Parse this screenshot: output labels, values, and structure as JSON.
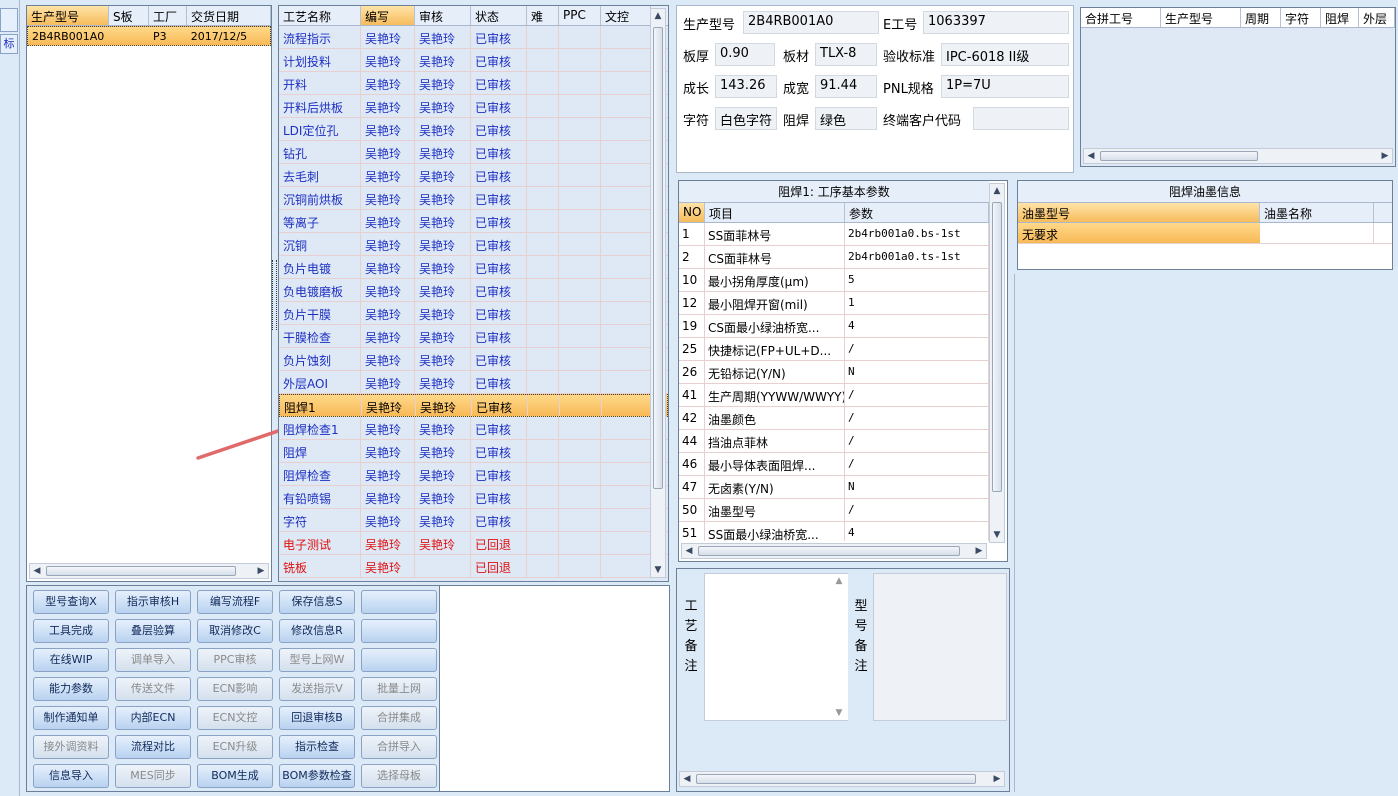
{
  "left_edge": {
    "top_label": "标"
  },
  "models": {
    "headers": [
      "生产型号",
      "S板",
      "工厂",
      "交货日期"
    ],
    "rows": [
      [
        "2B4RB001A0",
        "",
        "P3",
        "2017/12/5"
      ]
    ]
  },
  "process": {
    "headers": [
      "工艺名称",
      "编写",
      "审核",
      "状态",
      "难",
      "PPC",
      "文控"
    ],
    "rows": [
      {
        "name": "流程指示",
        "writer": "吴艳玲",
        "reviewer": "吴艳玲",
        "status": "已审核",
        "red": false
      },
      {
        "name": "计划投料",
        "writer": "吴艳玲",
        "reviewer": "吴艳玲",
        "status": "已审核",
        "red": false
      },
      {
        "name": "开料",
        "writer": "吴艳玲",
        "reviewer": "吴艳玲",
        "status": "已审核",
        "red": false
      },
      {
        "name": "开料后烘板",
        "writer": "吴艳玲",
        "reviewer": "吴艳玲",
        "status": "已审核",
        "red": false
      },
      {
        "name": "LDI定位孔",
        "writer": "吴艳玲",
        "reviewer": "吴艳玲",
        "status": "已审核",
        "red": false
      },
      {
        "name": "钻孔",
        "writer": "吴艳玲",
        "reviewer": "吴艳玲",
        "status": "已审核",
        "red": false
      },
      {
        "name": "去毛刺",
        "writer": "吴艳玲",
        "reviewer": "吴艳玲",
        "status": "已审核",
        "red": false
      },
      {
        "name": "沉铜前烘板",
        "writer": "吴艳玲",
        "reviewer": "吴艳玲",
        "status": "已审核",
        "red": false
      },
      {
        "name": "等离子",
        "writer": "吴艳玲",
        "reviewer": "吴艳玲",
        "status": "已审核",
        "red": false
      },
      {
        "name": "沉铜",
        "writer": "吴艳玲",
        "reviewer": "吴艳玲",
        "status": "已审核",
        "red": false
      },
      {
        "name": "负片电镀",
        "writer": "吴艳玲",
        "reviewer": "吴艳玲",
        "status": "已审核",
        "red": false
      },
      {
        "name": "负电镀磨板",
        "writer": "吴艳玲",
        "reviewer": "吴艳玲",
        "status": "已审核",
        "red": false
      },
      {
        "name": "负片干膜",
        "writer": "吴艳玲",
        "reviewer": "吴艳玲",
        "status": "已审核",
        "red": false
      },
      {
        "name": "干膜检查",
        "writer": "吴艳玲",
        "reviewer": "吴艳玲",
        "status": "已审核",
        "red": false
      },
      {
        "name": "负片蚀刻",
        "writer": "吴艳玲",
        "reviewer": "吴艳玲",
        "status": "已审核",
        "red": false
      },
      {
        "name": "外层AOI",
        "writer": "吴艳玲",
        "reviewer": "吴艳玲",
        "status": "已审核",
        "red": false
      },
      {
        "name": "阻焊1",
        "writer": "吴艳玲",
        "reviewer": "吴艳玲",
        "status": "已审核",
        "red": false,
        "selected": true
      },
      {
        "name": "阻焊检查1",
        "writer": "吴艳玲",
        "reviewer": "吴艳玲",
        "status": "已审核",
        "red": false
      },
      {
        "name": "阻焊",
        "writer": "吴艳玲",
        "reviewer": "吴艳玲",
        "status": "已审核",
        "red": false
      },
      {
        "name": "阻焊检查",
        "writer": "吴艳玲",
        "reviewer": "吴艳玲",
        "status": "已审核",
        "red": false
      },
      {
        "name": "有铅喷锡",
        "writer": "吴艳玲",
        "reviewer": "吴艳玲",
        "status": "已审核",
        "red": false
      },
      {
        "name": "字符",
        "writer": "吴艳玲",
        "reviewer": "吴艳玲",
        "status": "已审核",
        "red": false
      },
      {
        "name": "电子测试",
        "writer": "吴艳玲",
        "reviewer": "吴艳玲",
        "status": "已回退",
        "red": true
      },
      {
        "name": "铣板",
        "writer": "吴艳玲",
        "reviewer": "",
        "status": "已回退",
        "red": true
      }
    ]
  },
  "buttons": [
    [
      {
        "label": "型号查询X",
        "enabled": true
      },
      {
        "label": "指示审核H",
        "enabled": true
      },
      {
        "label": "编写流程F",
        "enabled": true
      },
      {
        "label": "保存信息S",
        "enabled": true
      },
      {
        "label": "",
        "enabled": true
      }
    ],
    [
      {
        "label": "工具完成",
        "enabled": true
      },
      {
        "label": "叠层验算",
        "enabled": true
      },
      {
        "label": "取消修改C",
        "enabled": true
      },
      {
        "label": "修改信息R",
        "enabled": true
      },
      {
        "label": "",
        "enabled": true
      }
    ],
    [
      {
        "label": "在线WIP",
        "enabled": true
      },
      {
        "label": "调单导入",
        "enabled": false
      },
      {
        "label": "PPC审核",
        "enabled": false
      },
      {
        "label": "型号上网W",
        "enabled": false
      },
      {
        "label": "",
        "enabled": true
      }
    ],
    [
      {
        "label": "能力参数",
        "enabled": true
      },
      {
        "label": "传送文件",
        "enabled": false
      },
      {
        "label": "ECN影响",
        "enabled": false
      },
      {
        "label": "发送指示V",
        "enabled": false
      },
      {
        "label": "批量上网",
        "enabled": false
      }
    ],
    [
      {
        "label": "制作通知单",
        "enabled": true
      },
      {
        "label": "内部ECN",
        "enabled": true
      },
      {
        "label": "ECN文控",
        "enabled": false
      },
      {
        "label": "回退审核B",
        "enabled": true
      },
      {
        "label": "合拼集成",
        "enabled": false
      }
    ],
    [
      {
        "label": "接外调资料",
        "enabled": false
      },
      {
        "label": "流程对比",
        "enabled": true
      },
      {
        "label": "ECN升级",
        "enabled": false
      },
      {
        "label": "指示检查",
        "enabled": true
      },
      {
        "label": "合拼导入",
        "enabled": false
      }
    ],
    [
      {
        "label": "信息导入",
        "enabled": true
      },
      {
        "label": "MES同步",
        "enabled": false
      },
      {
        "label": "BOM生成",
        "enabled": true
      },
      {
        "label": "BOM参数检查",
        "enabled": true
      },
      {
        "label": "选择母板",
        "enabled": false
      }
    ]
  ],
  "info": {
    "model_label": "生产型号",
    "model_value": "2B4RB001A0",
    "e_label": "E工号",
    "e_value": "1063397",
    "thickness_label": "板厚",
    "thickness_value": "0.90",
    "material_label": "板材",
    "material_value": "TLX-8",
    "standard_label": "验收标准",
    "standard_value": "IPC-6018 II级",
    "length_label": "成长",
    "length_value": "143.26",
    "width_label": "成宽",
    "width_value": "91.44",
    "pnl_label": "PNL规格",
    "pnl_value": "1P=7U",
    "char_label": "字符",
    "char_value": "白色字符",
    "mask_label": "阻焊",
    "mask_value": "绿色",
    "customer_label": "终端客户代码",
    "customer_value": ""
  },
  "merge": {
    "headers": [
      "合拼工号",
      "生产型号",
      "周期",
      "字符",
      "阻焊",
      "外层"
    ]
  },
  "params": {
    "title": "阻焊1: 工序基本参数",
    "headers": [
      "NO",
      "项目",
      "参数"
    ],
    "rows": [
      [
        "1",
        "SS面菲林号",
        "2b4rb001a0.bs-1st"
      ],
      [
        "2",
        "CS面菲林号",
        "2b4rb001a0.ts-1st"
      ],
      [
        "10",
        "最小拐角厚度(μm)",
        "5"
      ],
      [
        "12",
        "最小阻焊开窗(mil)",
        "1"
      ],
      [
        "19",
        "CS面最小绿油桥宽...",
        "4"
      ],
      [
        "25",
        "快捷标记(FP+UL+D...",
        "/"
      ],
      [
        "26",
        "无铅标记(Y/N)",
        "N"
      ],
      [
        "41",
        "生产周期(YYWW/WWYY)",
        "/"
      ],
      [
        "42",
        "油墨颜色",
        "/"
      ],
      [
        "44",
        "挡油点菲林",
        "/"
      ],
      [
        "46",
        "最小导体表面阻焊...",
        "/"
      ],
      [
        "47",
        "无卤素(Y/N)",
        "N"
      ],
      [
        "50",
        "油墨型号",
        "/"
      ],
      [
        "51",
        "SS面最小绿油桥宽...",
        "4"
      ]
    ]
  },
  "ink": {
    "title": "阻焊油墨信息",
    "headers": [
      "油墨型号",
      "油墨名称"
    ],
    "rows": [
      [
        "无要求",
        ""
      ]
    ]
  },
  "remarks": {
    "process_label": "工艺备注",
    "model_label": "型号备注"
  },
  "colors": {
    "accent_orange": "#f8b956",
    "link_blue": "#1d2fc1",
    "alert_red": "#e0100f",
    "arrow_red": "#e06a6a"
  }
}
